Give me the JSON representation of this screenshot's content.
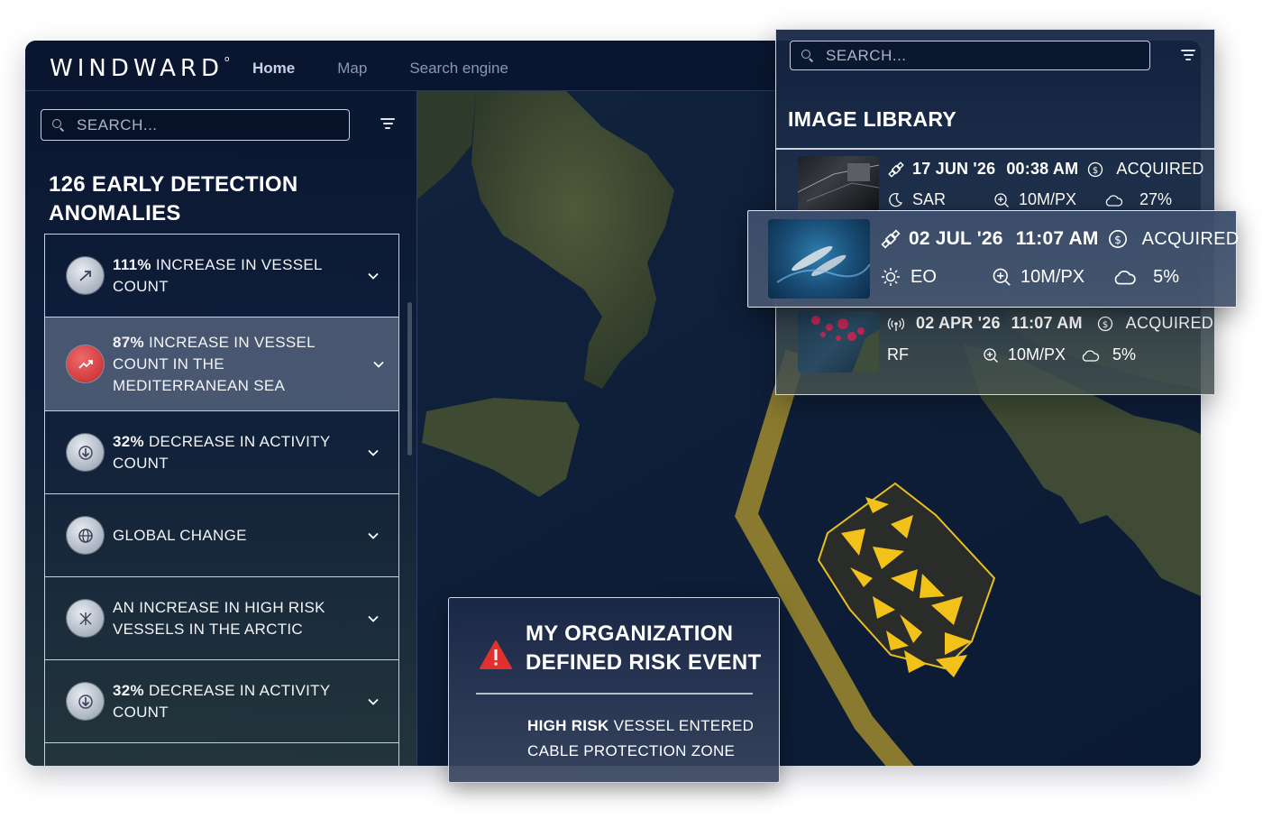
{
  "app": {
    "logo": "WINDWARD",
    "logo_mark": "o",
    "nav": [
      {
        "label": "Home",
        "active": true
      },
      {
        "label": "Map",
        "active": false
      },
      {
        "label": "Search engine",
        "active": false
      }
    ]
  },
  "sidebar": {
    "search_placeholder": "SEARCH...",
    "title": "126 EARLY DETECTION ANOMALIES",
    "anomalies": [
      {
        "bold": "111%",
        "text": " INCREASE IN VESSEL COUNT",
        "icon": "trend-up-icon"
      },
      {
        "bold": "87%",
        "text": " INCREASE IN VESSEL COUNT IN THE MEDITERRANEAN SEA",
        "icon": "trend-chart-icon",
        "selected": true
      },
      {
        "bold": "32%",
        "text": " DECREASE IN ACTIVITY COUNT",
        "icon": "trend-down-icon"
      },
      {
        "bold": "",
        "text": "GLOBAL CHANGE",
        "icon": "globe-icon"
      },
      {
        "bold": "",
        "text": "AN INCREASE IN HIGH RISK VESSELS IN THE ARCTIC",
        "icon": "arctic-icon"
      },
      {
        "bold": "32%",
        "text": " DECREASE IN ACTIVITY COUNT",
        "icon": "trend-down-icon"
      }
    ]
  },
  "risk_event": {
    "title": "MY ORGANIZATION DEFINED RISK EVENT",
    "desc_bold": "HIGH RISK",
    "desc_text": " VESSEL ENTERED CABLE PROTECTION ZONE"
  },
  "image_library": {
    "search_placeholder": "SEARCH...",
    "title": "IMAGE LIBRARY",
    "images": [
      {
        "date": "17 JUN '26",
        "time": "00:38 AM",
        "status": "ACQUIRED",
        "type": "SAR",
        "resolution": "10M/PX",
        "cloud": "27%",
        "source_icon": "satellite-icon",
        "type_icon": "moon-icon"
      },
      {
        "date": "02 JUL '26",
        "time": "11:07 AM",
        "status": "ACQUIRED",
        "type": "EO",
        "resolution": "10M/PX",
        "cloud": "5%",
        "source_icon": "satellite-icon",
        "type_icon": "sun-icon"
      },
      {
        "date": "02 APR '26",
        "time": "11:07 AM",
        "status": "ACQUIRED",
        "type": "RF",
        "resolution": "10M/PX",
        "cloud": "5%",
        "source_icon": "radio-signal-icon",
        "type_icon": ""
      }
    ]
  },
  "colors": {
    "background": "#0b1830",
    "cable_zone": "#8a7a30",
    "vessel_marker": "#f2c21b",
    "alert_red": "#e2302f"
  }
}
